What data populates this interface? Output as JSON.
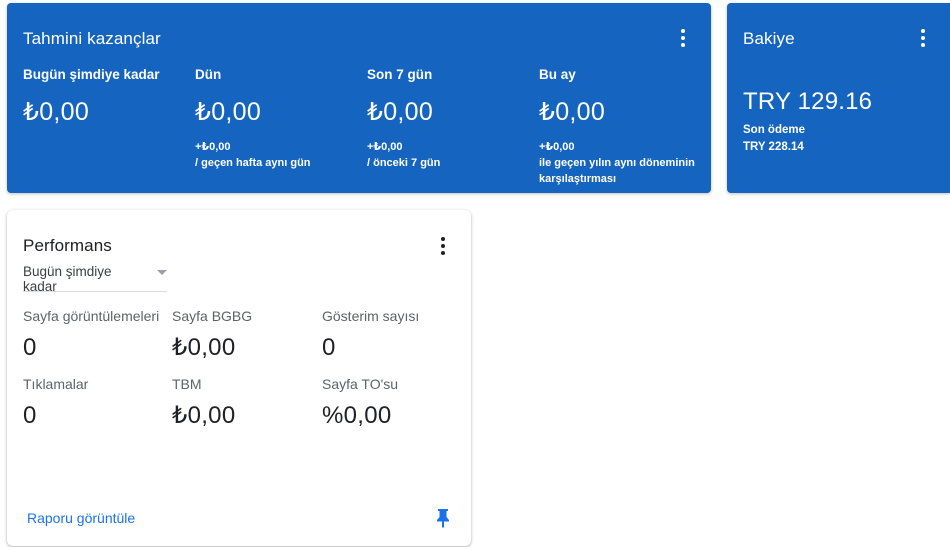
{
  "earnings": {
    "title": "Tahmini kazançlar",
    "metrics": [
      {
        "label": "Bugün şimdiye kadar",
        "value": "₺0,00",
        "delta": "",
        "compare": ""
      },
      {
        "label": "Dün",
        "value": "₺0,00",
        "delta": "+₺0,00",
        "compare": "/ geçen hafta aynı gün"
      },
      {
        "label": "Son 7 gün",
        "value": "₺0,00",
        "delta": "+₺0,00",
        "compare": "/ önceki 7 gün"
      },
      {
        "label": "Bu ay",
        "value": "₺0,00",
        "delta": "+₺0,00",
        "compare": "ile geçen yılın aynı döneminin karşılaştırması"
      }
    ]
  },
  "balance": {
    "title": "Bakiye",
    "amount": "TRY 129.16",
    "last_payment_label": "Son ödeme",
    "last_payment_value": "TRY 228.14"
  },
  "performance": {
    "title": "Performans",
    "range": "Bugün şimdiye kadar",
    "metrics": [
      {
        "label": "Sayfa görüntülemeleri",
        "value": "0"
      },
      {
        "label": "Sayfa BGBG",
        "value": "₺0,00"
      },
      {
        "label": "Gösterim sayısı",
        "value": "0"
      },
      {
        "label": "Tıklamalar",
        "value": "0"
      },
      {
        "label": "TBM",
        "value": "₺0,00"
      },
      {
        "label": "Sayfa TO'su",
        "value": "%0,00"
      }
    ],
    "report_link": "Raporu görüntüle"
  },
  "colors": {
    "card_blue": "#1565c0",
    "link": "#1a73e8"
  },
  "icons": [
    "more-vert-icon",
    "dropdown-caret-icon",
    "pin-icon"
  ]
}
